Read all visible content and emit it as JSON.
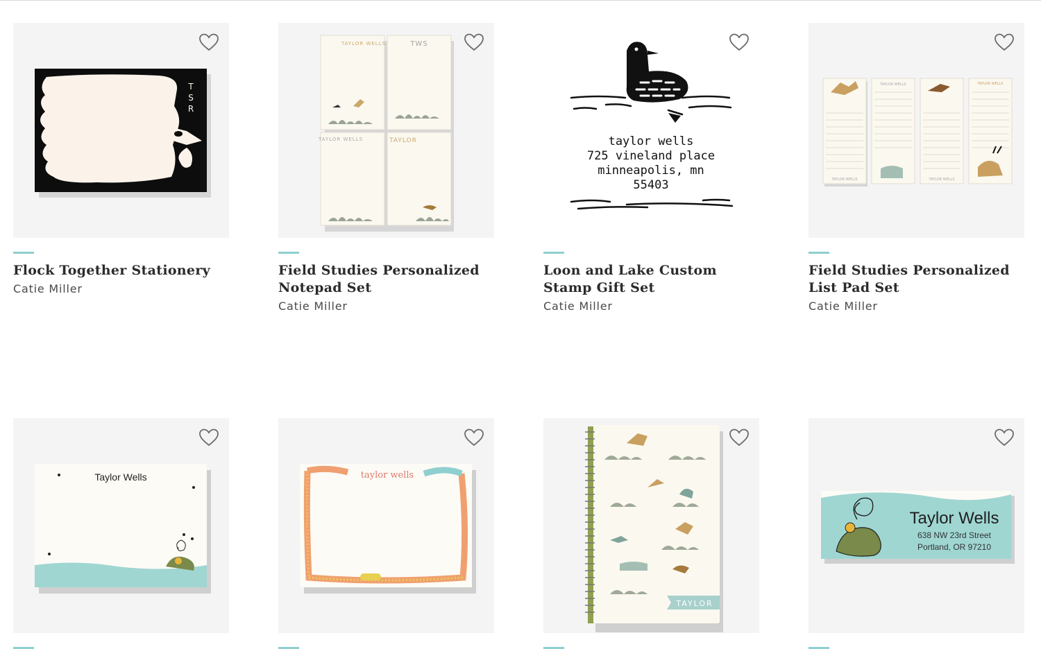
{
  "colors": {
    "accent": "#8fcfcf",
    "thumb_bg": "#f4f4f4",
    "heart_stroke": "#6b6b6b",
    "title": "#2b2b2b",
    "artist": "#4a4a4a"
  },
  "products": [
    {
      "title": "Flock Together Stationery",
      "artist": "Catie Miller",
      "favorite_icon": "heart-outline-icon",
      "artwork": {
        "monogram": [
          "T",
          "S",
          "R"
        ]
      }
    },
    {
      "title": "Field Studies Personalized Notepad Set",
      "artist": "Catie Miller",
      "favorite_icon": "heart-outline-icon",
      "artwork": {
        "labels": [
          "TAYLOR WELLS",
          "TWS",
          "TAYLOR WELLS",
          "TAYLOR"
        ]
      }
    },
    {
      "title": "Loon and Lake Custom Stamp Gift Set",
      "artist": "Catie Miller",
      "favorite_icon": "heart-outline-icon",
      "artwork": {
        "address_lines": [
          "taylor wells",
          "725 vineland place",
          "minneapolis, mn",
          "55403"
        ]
      }
    },
    {
      "title": "Field Studies Personalized List Pad Set",
      "artist": "Catie Miller",
      "favorite_icon": "heart-outline-icon",
      "artwork": {
        "labels": [
          "TAYLOR WELLS",
          "TAYLOR WELLS",
          "TAYLOR WELLS",
          "TAYLOR WELLS"
        ]
      }
    },
    {
      "favorite_icon": "heart-outline-icon",
      "artwork": {
        "name": "Taylor Wells"
      }
    },
    {
      "favorite_icon": "heart-outline-icon",
      "artwork": {
        "name": "taylor wells"
      }
    },
    {
      "favorite_icon": "heart-outline-icon",
      "artwork": {
        "name": "TAYLOR"
      }
    },
    {
      "favorite_icon": "heart-outline-icon",
      "artwork": {
        "name": "Taylor Wells",
        "address_lines": [
          "638 NW 23rd Street",
          "Portland, OR 97210"
        ]
      }
    }
  ]
}
